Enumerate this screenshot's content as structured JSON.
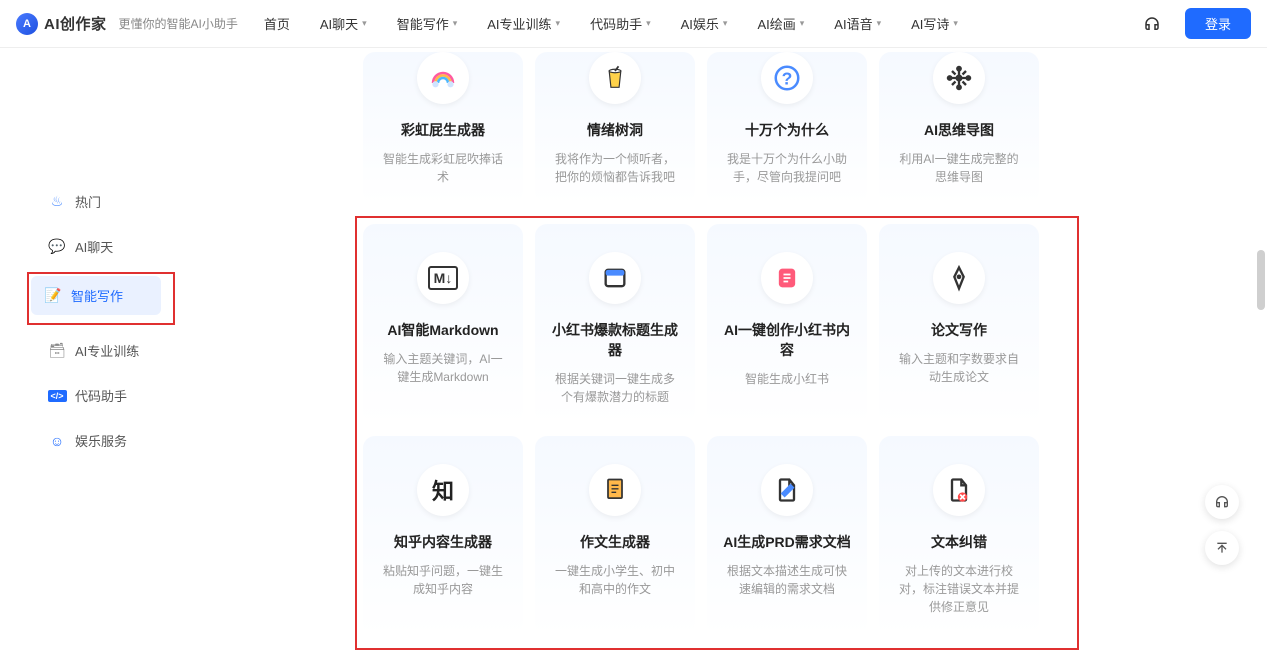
{
  "header": {
    "logo_text": "AI创作家",
    "tagline": "更懂你的智能AI小助手",
    "nav": [
      {
        "label": "首页",
        "dropdown": false
      },
      {
        "label": "AI聊天",
        "dropdown": true
      },
      {
        "label": "智能写作",
        "dropdown": true
      },
      {
        "label": "AI专业训练",
        "dropdown": true
      },
      {
        "label": "代码助手",
        "dropdown": true
      },
      {
        "label": "AI娱乐",
        "dropdown": true
      },
      {
        "label": "AI绘画",
        "dropdown": true
      },
      {
        "label": "AI语音",
        "dropdown": true
      },
      {
        "label": "AI写诗",
        "dropdown": true
      }
    ],
    "login_label": "登录"
  },
  "sidebar": {
    "items": [
      {
        "icon": "flame",
        "label": "热门"
      },
      {
        "icon": "chat",
        "label": "AI聊天"
      },
      {
        "icon": "edit",
        "label": "智能写作",
        "active": true
      },
      {
        "icon": "cube",
        "label": "AI专业训练"
      },
      {
        "icon": "code",
        "label": "代码助手"
      },
      {
        "icon": "smile",
        "label": "娱乐服务"
      }
    ]
  },
  "cards_top": [
    {
      "icon": "🌈",
      "title": "彩虹屁生成器",
      "desc": "智能生成彩虹屁吹捧话术"
    },
    {
      "icon": "🥤",
      "title": "情绪树洞",
      "desc": "我将作为一个倾听者，把你的烦恼都告诉我吧"
    },
    {
      "icon": "❓",
      "title": "十万个为什么",
      "desc": "我是十万个为什么小助手，尽管向我提问吧"
    },
    {
      "icon": "🧠",
      "title": "AI思维导图",
      "desc": "利用AI一键生成完整的思维导图"
    }
  ],
  "cards_row1": [
    {
      "icon": "M↓",
      "title": "AI智能Markdown",
      "desc": "输入主题关键词，AI一键生成Markdown"
    },
    {
      "icon": "🗔",
      "title": "小红书爆款标题生成器",
      "desc": "根据关键词一键生成多个有爆款潜力的标题"
    },
    {
      "icon": "📕",
      "title": "AI一键创作小红书内容",
      "desc": "智能生成小红书"
    },
    {
      "icon": "✒️",
      "title": "论文写作",
      "desc": "输入主题和字数要求自动生成论文"
    }
  ],
  "cards_row2": [
    {
      "icon": "知",
      "title": "知乎内容生成器",
      "desc": "粘贴知乎问题，一键生成知乎内容"
    },
    {
      "icon": "📄",
      "title": "作文生成器",
      "desc": "一键生成小学生、初中和高中的作文"
    },
    {
      "icon": "📝",
      "title": "AI生成PRD需求文档",
      "desc": "根据文本描述生成可快速编辑的需求文档"
    },
    {
      "icon": "🗑️",
      "title": "文本纠错",
      "desc": "对上传的文本进行校对，标注错误文本并提供修正意见"
    }
  ]
}
